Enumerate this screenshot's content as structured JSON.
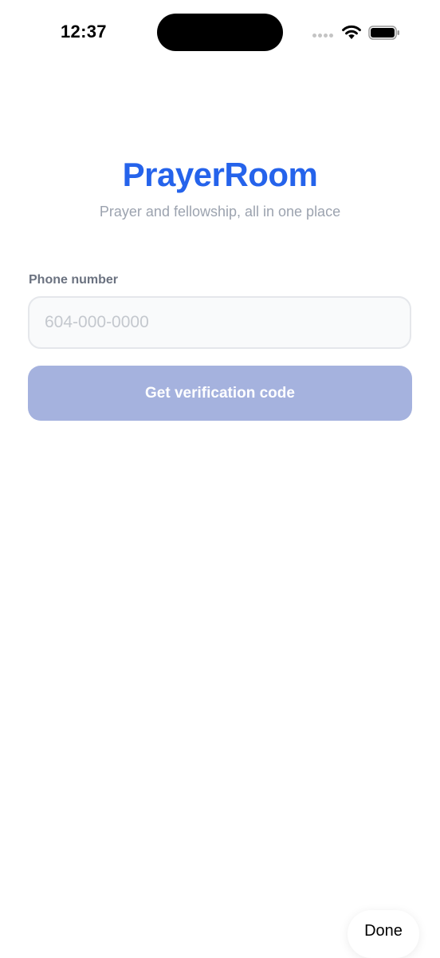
{
  "status_bar": {
    "time": "12:37"
  },
  "header": {
    "title": "PrayerRoom",
    "subtitle": "Prayer and fellowship, all in one place"
  },
  "form": {
    "phone_label": "Phone number",
    "phone_value": "",
    "phone_placeholder": "604-000-0000",
    "submit_label": "Get verification code"
  },
  "keyboard": {
    "done_label": "Done"
  },
  "colors": {
    "brand": "#2563eb",
    "button_disabled": "#a5b2de",
    "subtitle": "#9ca3af",
    "label": "#6b7280",
    "input_border": "#e5e7eb",
    "input_background": "#f9fafb"
  },
  "icons": {
    "signal": "cellular-signal-icon",
    "wifi": "wifi-icon",
    "battery": "battery-icon"
  }
}
